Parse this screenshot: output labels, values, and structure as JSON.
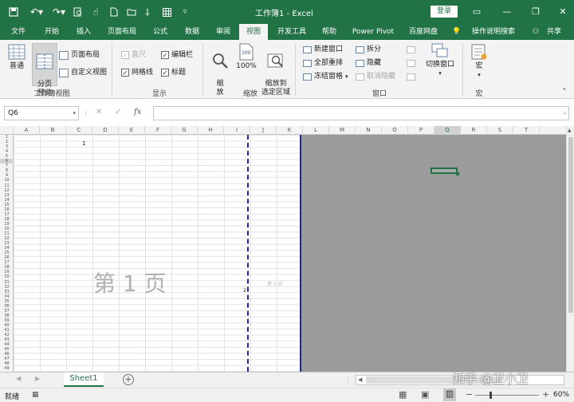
{
  "titlebar": {
    "title": "工作簿1 - Excel",
    "login_label": "登录",
    "bg_color": "#217346"
  },
  "quick_access": {
    "icons": [
      "save-icon",
      "undo-icon",
      "redo-icon",
      "print-preview-icon",
      "touch-mode-icon",
      "new-file-icon",
      "open-folder-icon",
      "customize-icon",
      "table-icon",
      "dropdown-icon"
    ]
  },
  "tabs": [
    {
      "label": "文件",
      "active": false
    },
    {
      "label": "开始",
      "active": false
    },
    {
      "label": "插入",
      "active": false
    },
    {
      "label": "页面布局",
      "active": false
    },
    {
      "label": "公式",
      "active": false
    },
    {
      "label": "数据",
      "active": false
    },
    {
      "label": "审阅",
      "active": false
    },
    {
      "label": "视图",
      "active": true
    },
    {
      "label": "开发工具",
      "active": false
    },
    {
      "label": "帮助",
      "active": false
    },
    {
      "label": "Power Pivot",
      "active": false
    },
    {
      "label": "百度网盘",
      "active": false
    },
    {
      "label": "操作说明搜索",
      "active": false
    },
    {
      "label": "共享",
      "active": false
    }
  ],
  "ribbon": {
    "workbook_views": {
      "group_label": "工作簿视图",
      "normal": "普通",
      "page_break_preview": "分页\n预览",
      "page_layout": "页面布局",
      "custom_views": "自定义视图"
    },
    "show": {
      "group_label": "显示",
      "ruler": "直尺",
      "gridlines": "网格线",
      "formula_bar": "编辑栏",
      "headings": "标题",
      "ruler_checked": true,
      "gridlines_checked": true,
      "formula_bar_checked": true,
      "headings_checked": true
    },
    "zoom": {
      "group_label": "缩放",
      "zoom": "缩\n放",
      "hundred": "100%",
      "zoom_to_selection": "缩放到\n选定区域"
    },
    "window": {
      "group_label": "窗口",
      "new_window": "新建窗口",
      "arrange_all": "全部重排",
      "freeze_panes": "冻结窗格",
      "split": "拆分",
      "hide": "隐藏",
      "unhide": "取消隐藏",
      "switch_windows": "切换窗口"
    },
    "macros": {
      "group_label": "宏",
      "macros": "宏"
    }
  },
  "formula_bar": {
    "name_box": "Q6",
    "formula": ""
  },
  "grid": {
    "columns": [
      "A",
      "B",
      "C",
      "D",
      "E",
      "F",
      "G",
      "H",
      "I",
      "J",
      "K",
      "L",
      "M",
      "N",
      "O",
      "P",
      "Q",
      "R",
      "S",
      "T"
    ],
    "selected_column": "Q",
    "rows": [
      "1",
      "2",
      "3",
      "4",
      "5",
      "6",
      "7",
      "8",
      "9",
      "10",
      "11",
      "12",
      "13",
      "14",
      "15",
      "16",
      "17",
      "18",
      "19",
      "20",
      "21",
      "22",
      "23",
      "24",
      "25",
      "26",
      "27",
      "28",
      "29",
      "30",
      "31",
      "32",
      "33",
      "34",
      "35",
      "36",
      "37",
      "38",
      "39",
      "40",
      "41",
      "42",
      "43",
      "44",
      "45",
      "46",
      "47",
      "48",
      "49"
    ],
    "selected_row": "6",
    "cell_c2": "1",
    "cell_i24": "2",
    "page1_watermark": "第 1 页",
    "page2_watermark": "第 2 页"
  },
  "sheet_tabs": {
    "tabs": [
      "Sheet1"
    ],
    "active": "Sheet1"
  },
  "status": {
    "ready": "就绪",
    "zoom_level": "60%"
  },
  "watermark": "知乎 @卫小卫"
}
